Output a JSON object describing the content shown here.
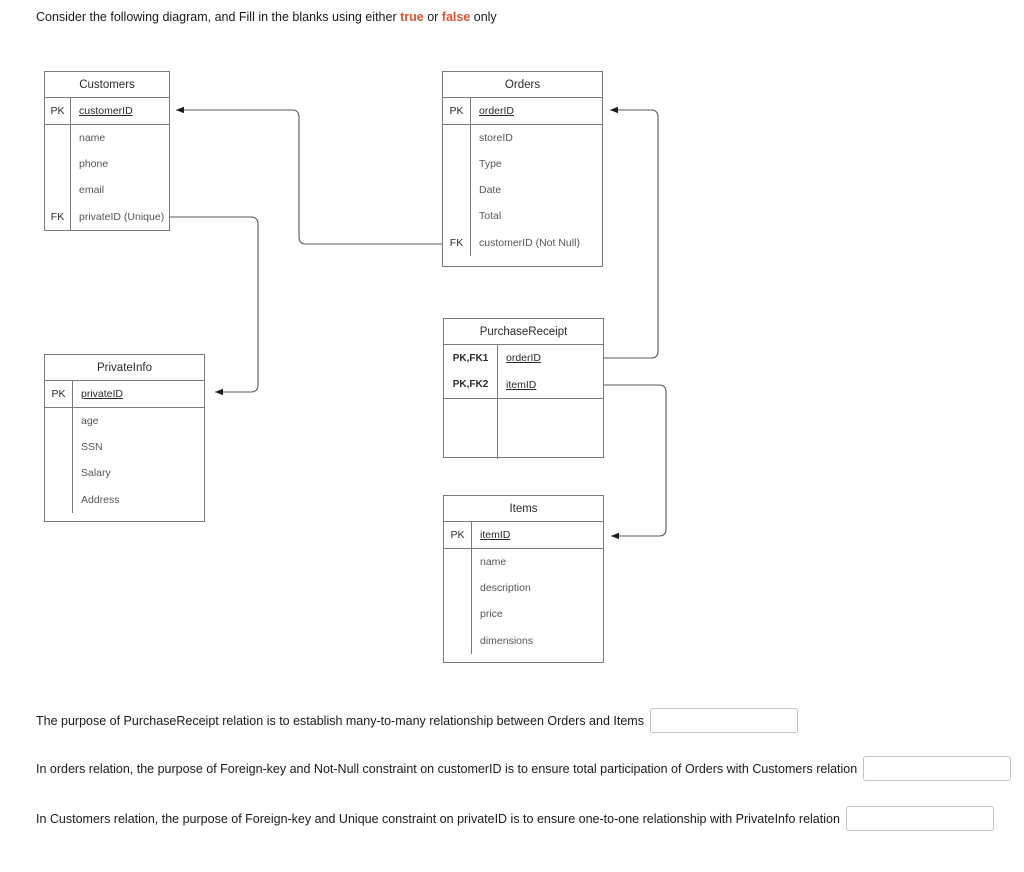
{
  "prompt": {
    "part1": "Consider the following diagram, and Fill in the blanks using either ",
    "kw_true": "true",
    "part2": " or ",
    "kw_false": "false",
    "part3": " only"
  },
  "diagram": {
    "entities": [
      {
        "name": "Customers",
        "keys": [
          {
            "key": "PK",
            "attr": "customerID",
            "underline": true
          }
        ],
        "attrs": [
          {
            "key": "",
            "attr": "name"
          },
          {
            "key": "",
            "attr": "phone"
          },
          {
            "key": "",
            "attr": "email"
          },
          {
            "key": "FK",
            "attr": "privateID (Unique)"
          }
        ]
      },
      {
        "name": "Orders",
        "keys": [
          {
            "key": "PK",
            "attr": "orderID",
            "underline": true
          }
        ],
        "attrs": [
          {
            "key": "",
            "attr": "storeID"
          },
          {
            "key": "",
            "attr": "Type"
          },
          {
            "key": "",
            "attr": "Date"
          },
          {
            "key": "",
            "attr": "Total"
          },
          {
            "key": "FK",
            "attr": "customerID (Not Null)"
          }
        ]
      },
      {
        "name": "PurchaseReceipt",
        "keys": [
          {
            "key": "PK,FK1",
            "attr": "orderID",
            "underline": true
          },
          {
            "key": "PK,FK2",
            "attr": "itemID",
            "underline": true
          }
        ],
        "attrs": [
          {
            "key": "",
            "attr": ""
          },
          {
            "key": "",
            "attr": ""
          }
        ]
      },
      {
        "name": "Items",
        "keys": [
          {
            "key": "PK",
            "attr": "itemID",
            "underline": true
          }
        ],
        "attrs": [
          {
            "key": "",
            "attr": "name"
          },
          {
            "key": "",
            "attr": "description"
          },
          {
            "key": "",
            "attr": "price"
          },
          {
            "key": "",
            "attr": "dimensions"
          }
        ]
      },
      {
        "name": "PrivateInfo",
        "keys": [
          {
            "key": "PK",
            "attr": "privateID",
            "underline": true
          }
        ],
        "attrs": [
          {
            "key": "",
            "attr": "age"
          },
          {
            "key": "",
            "attr": "SSN"
          },
          {
            "key": "",
            "attr": "Salary"
          },
          {
            "key": "",
            "attr": "Address"
          }
        ]
      }
    ],
    "line_color": "#585858"
  },
  "questions": [
    {
      "text": "The purpose of PurchaseReceipt relation is to establish many-to-many relationship between Orders and Items",
      "value": "",
      "placeholder": ""
    },
    {
      "text": "In orders relation, the purpose of Foreign-key and Not-Null constraint on customerID is to ensure total participation of Orders with Customers relation",
      "value": "",
      "placeholder": ""
    },
    {
      "text": "In Customers relation, the purpose of Foreign-key and Unique constraint on privateID is to ensure one-to-one relationship with PrivateInfo relation",
      "value": "",
      "placeholder": ""
    }
  ]
}
